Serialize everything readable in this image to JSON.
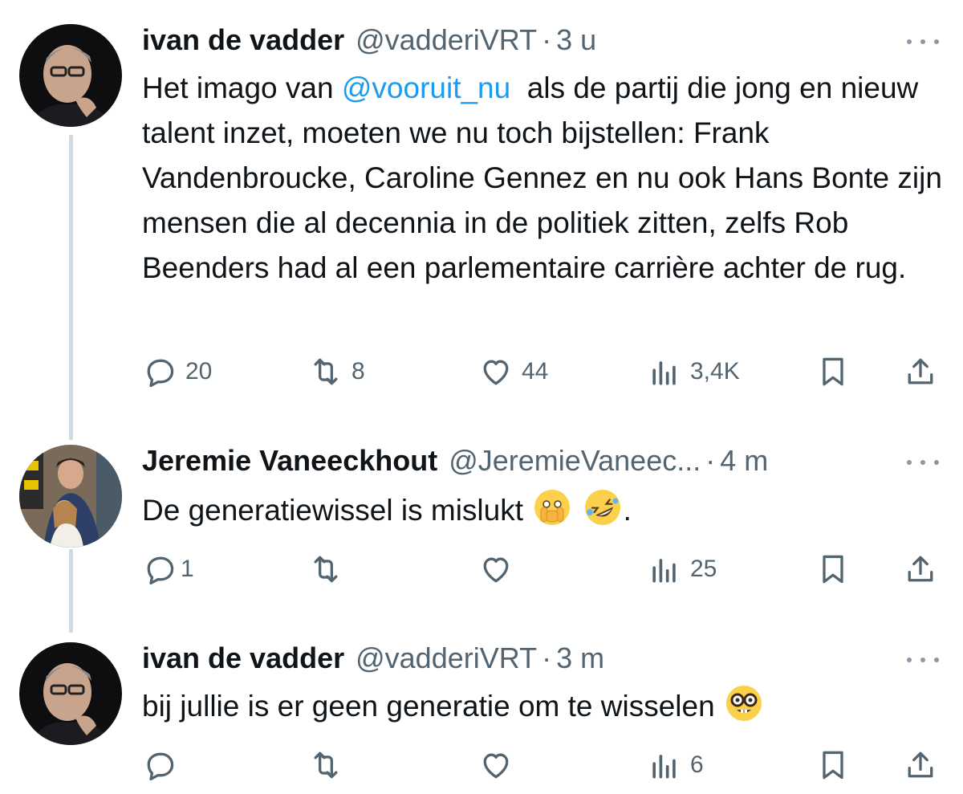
{
  "tweets": [
    {
      "name": "ivan de vadder",
      "handle": "@vadderiVRT",
      "separator": "·",
      "time": "3 u",
      "text_parts": [
        "Het imago van ",
        "@vooruit_nu",
        "  als de partij die jong en nieuw talent inzet, moeten we nu toch bijstellen: Frank Vandenbroucke, Caroline Gennez en nu ook Hans Bonte zijn mensen die al decennia in de politiek zitten, zelfs Rob Beenders had al een parlementaire carrière achter de rug."
      ],
      "replies": "20",
      "retweets": "8",
      "likes": "44",
      "views": "3,4K"
    },
    {
      "name": "Jeremie Vaneeckhout",
      "handle": "@JeremieVaneec...",
      "separator": "·",
      "time": "4 m",
      "text": "De generatiewissel is mislukt",
      "text_end": ".",
      "replies": "1",
      "retweets": "",
      "likes": "",
      "views": "25"
    },
    {
      "name": "ivan de vadder",
      "handle": "@vadderiVRT",
      "separator": "·",
      "time": "3 m",
      "text": "bij jullie is er geen generatie om te wisselen",
      "replies": "",
      "retweets": "",
      "likes": "",
      "views": "6"
    }
  ],
  "icons": {
    "reply": "reply-icon",
    "retweet": "retweet-icon",
    "like": "heart-icon",
    "views": "views-icon",
    "bookmark": "bookmark-icon",
    "share": "share-icon",
    "more": "more-icon"
  },
  "colors": {
    "text": "#0f1419",
    "muted": "#536471",
    "link": "#1d9bf0",
    "thread_line": "#cfd9de"
  }
}
